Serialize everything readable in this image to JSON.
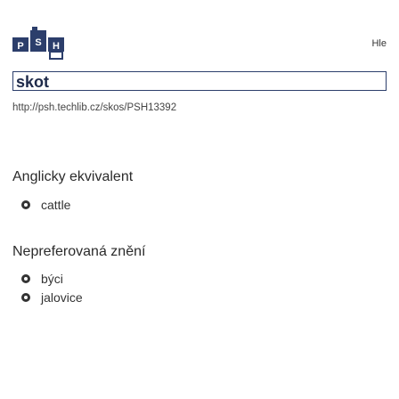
{
  "header": {
    "logo_letters": [
      "P",
      "S",
      "H"
    ],
    "search_link": "Hle"
  },
  "concept": {
    "title": "skot",
    "uri": "http://psh.techlib.cz/skos/PSH13392"
  },
  "sections": [
    {
      "title": "Anglicky ekvivalent",
      "items": [
        "cattle"
      ]
    },
    {
      "title": "Nepreferovaná znění",
      "items": [
        "býci",
        "jalovice"
      ]
    }
  ],
  "colors": {
    "logo_dark": "#2c3e6b",
    "logo_light": "#ffffff",
    "title_border": "#2c3e6b"
  }
}
